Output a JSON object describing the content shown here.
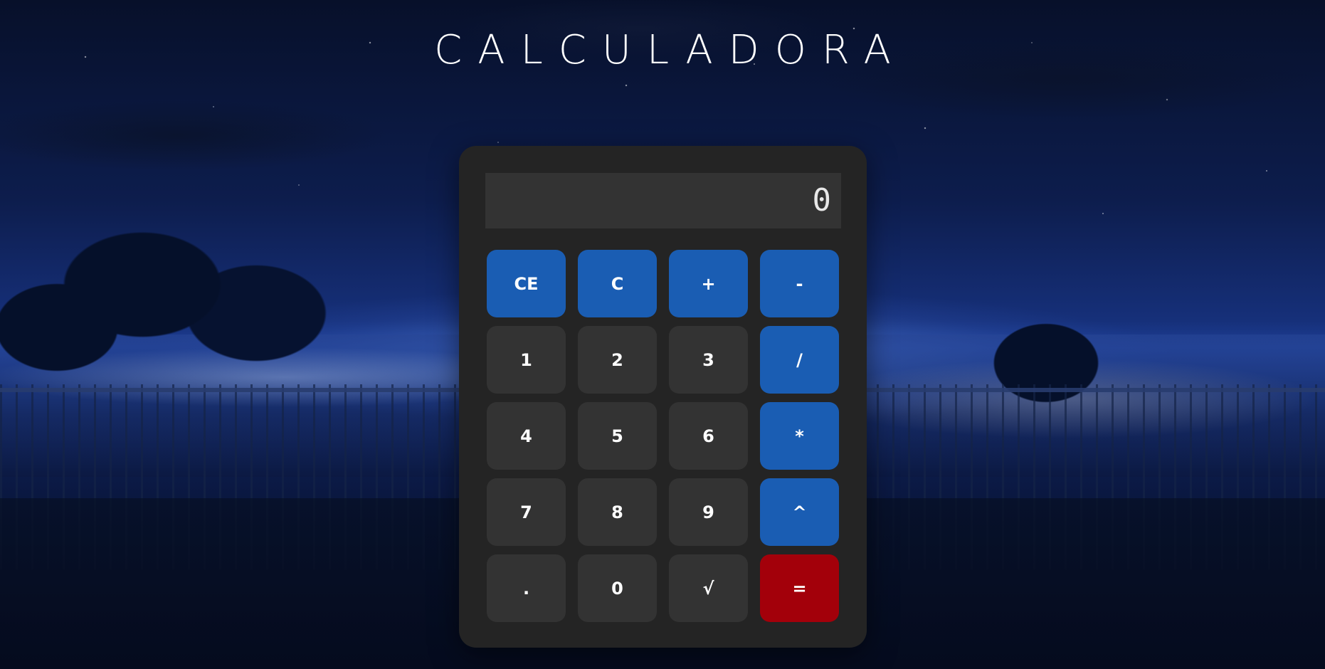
{
  "title": "CALCULADORA",
  "display": {
    "value": "0"
  },
  "colors": {
    "calculator_body": "#242424",
    "display_bg": "#333333",
    "number_key": "#333333",
    "operator_key": "#1a5db3",
    "equals_key": "#a3000a"
  },
  "keys": {
    "ce": "CE",
    "c": "C",
    "plus": "+",
    "minus": "-",
    "one": "1",
    "two": "2",
    "three": "3",
    "divide": "/",
    "four": "4",
    "five": "5",
    "six": "6",
    "multiply": "*",
    "seven": "7",
    "eight": "8",
    "nine": "9",
    "power": "^",
    "dot": ".",
    "zero": "0",
    "sqrt": "√",
    "equals": "="
  }
}
